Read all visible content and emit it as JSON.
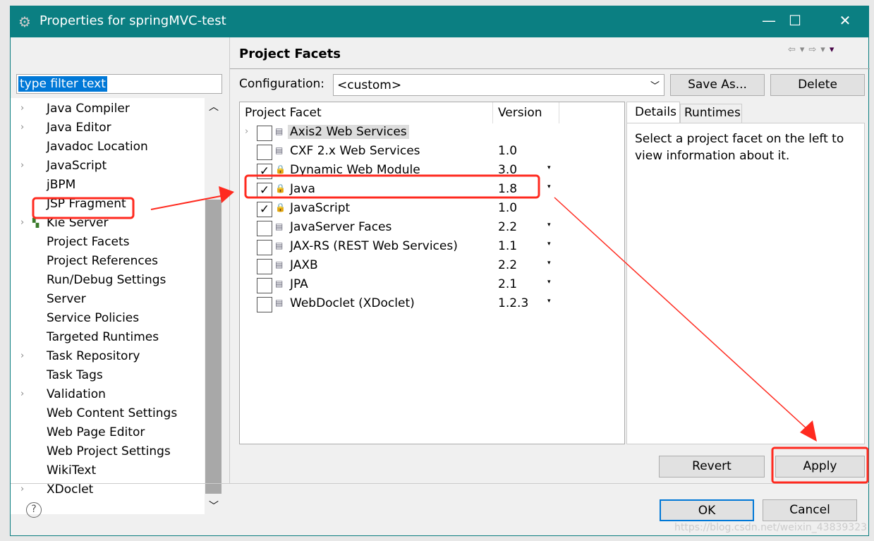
{
  "window": {
    "title": "Properties for springMVC-test",
    "minimize": "—",
    "maximize": "☐",
    "close": "✕"
  },
  "filter": {
    "value": "type filter text"
  },
  "tree": [
    {
      "label": "Java Compiler",
      "expand": true
    },
    {
      "label": "Java Editor",
      "expand": true
    },
    {
      "label": "Javadoc Location",
      "expand": false
    },
    {
      "label": "JavaScript",
      "expand": true
    },
    {
      "label": "jBPM",
      "expand": false
    },
    {
      "label": "JSP Fragment",
      "expand": false
    },
    {
      "label": "Kie Server",
      "expand": true,
      "icon": true
    },
    {
      "label": "Project Facets",
      "expand": false,
      "selected": true
    },
    {
      "label": "Project References",
      "expand": false
    },
    {
      "label": "Run/Debug Settings",
      "expand": false
    },
    {
      "label": "Server",
      "expand": false
    },
    {
      "label": "Service Policies",
      "expand": false
    },
    {
      "label": "Targeted Runtimes",
      "expand": false
    },
    {
      "label": "Task Repository",
      "expand": true
    },
    {
      "label": "Task Tags",
      "expand": false
    },
    {
      "label": "Validation",
      "expand": true
    },
    {
      "label": "Web Content Settings",
      "expand": false
    },
    {
      "label": "Web Page Editor",
      "expand": false
    },
    {
      "label": "Web Project Settings",
      "expand": false
    },
    {
      "label": "WikiText",
      "expand": false
    },
    {
      "label": "XDoclet",
      "expand": true
    }
  ],
  "page": {
    "title": "Project Facets",
    "config_label": "Configuration:",
    "config_value": "<custom>",
    "save_as": "Save As...",
    "delete": "Delete"
  },
  "table": {
    "headers": [
      "Project Facet",
      "Version"
    ],
    "rows": [
      {
        "name": "Axis2 Web Services",
        "version": "",
        "checked": false,
        "dropdown": false,
        "expand": true
      },
      {
        "name": "CXF 2.x Web Services",
        "version": "1.0",
        "checked": false,
        "dropdown": false
      },
      {
        "name": "Dynamic Web Module",
        "version": "3.0",
        "checked": true,
        "dropdown": true
      },
      {
        "name": "Java",
        "version": "1.8",
        "checked": true,
        "dropdown": true
      },
      {
        "name": "JavaScript",
        "version": "1.0",
        "checked": true,
        "dropdown": false
      },
      {
        "name": "JavaServer Faces",
        "version": "2.2",
        "checked": false,
        "dropdown": true
      },
      {
        "name": "JAX-RS (REST Web Services)",
        "version": "1.1",
        "checked": false,
        "dropdown": true
      },
      {
        "name": "JAXB",
        "version": "2.2",
        "checked": false,
        "dropdown": true
      },
      {
        "name": "JPA",
        "version": "2.1",
        "checked": false,
        "dropdown": true
      },
      {
        "name": "WebDoclet (XDoclet)",
        "version": "1.2.3",
        "checked": false,
        "dropdown": true
      }
    ]
  },
  "details": {
    "tabs": [
      "Details",
      "Runtimes"
    ],
    "text": "Select a project facet on the left to view information about it."
  },
  "buttons": {
    "revert": "Revert",
    "apply": "Apply",
    "ok": "OK",
    "cancel": "Cancel",
    "help": "?"
  },
  "annotation_color": "#ff2a1f",
  "watermark": "https://blog.csdn.net/weixin_43839323"
}
